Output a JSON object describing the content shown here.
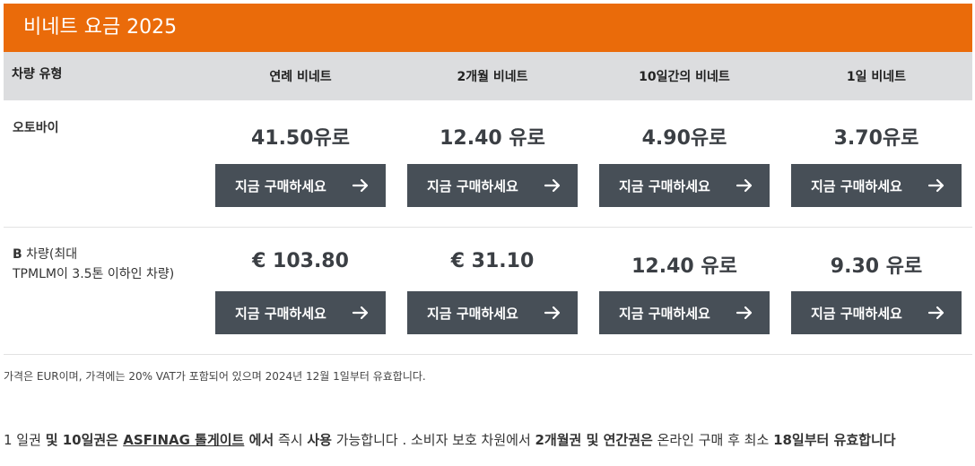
{
  "banner": {
    "title": "비네트 요금 2025"
  },
  "header": {
    "vehicle_type": "차량 유형",
    "columns": [
      "연례 비네트",
      "2개월 비네트",
      "10일간의 비네트",
      "1일 비네트"
    ]
  },
  "rows": [
    {
      "label": "오토바이",
      "prices": [
        "41.50유로",
        "12.40 유로",
        "4.90유로",
        "3.70유로"
      ],
      "button_label": "지금 구매하세요"
    },
    {
      "label_bold": "B",
      "label_line1": " 차량(최대",
      "label_line2": "TPMLM이 3.5톤 이하인 차량)",
      "prices": [
        "€ 103.80",
        "€ 31.10",
        "12.40 유로",
        "9.30 유로"
      ],
      "button_label": "지금 구매하세요"
    }
  ],
  "footnote": "가격은 EUR이며, 가격에는 20% VAT가 포함되어 있으며 2024년 12월 1일부터 유효합니다.",
  "info": {
    "p1": "1 일권 ",
    "b1": "및 10일권은 ",
    "link": "ASFINAG 톨게이트",
    "b2": " 에서",
    "p2": " 즉시 ",
    "b3": "사용",
    "p3": " 가능합니다 . 소비자 보호 차원에서 ",
    "b4": "2개월권 및 연간권은",
    "p4": " 온라인 구매 후 최소 ",
    "b5": "18일부터 유효합니다"
  },
  "colors": {
    "banner": "#ea6b0a",
    "header_bg": "#dcdddf",
    "button": "#474f57"
  },
  "icons": {
    "button_icon": "arrow-right-icon"
  }
}
